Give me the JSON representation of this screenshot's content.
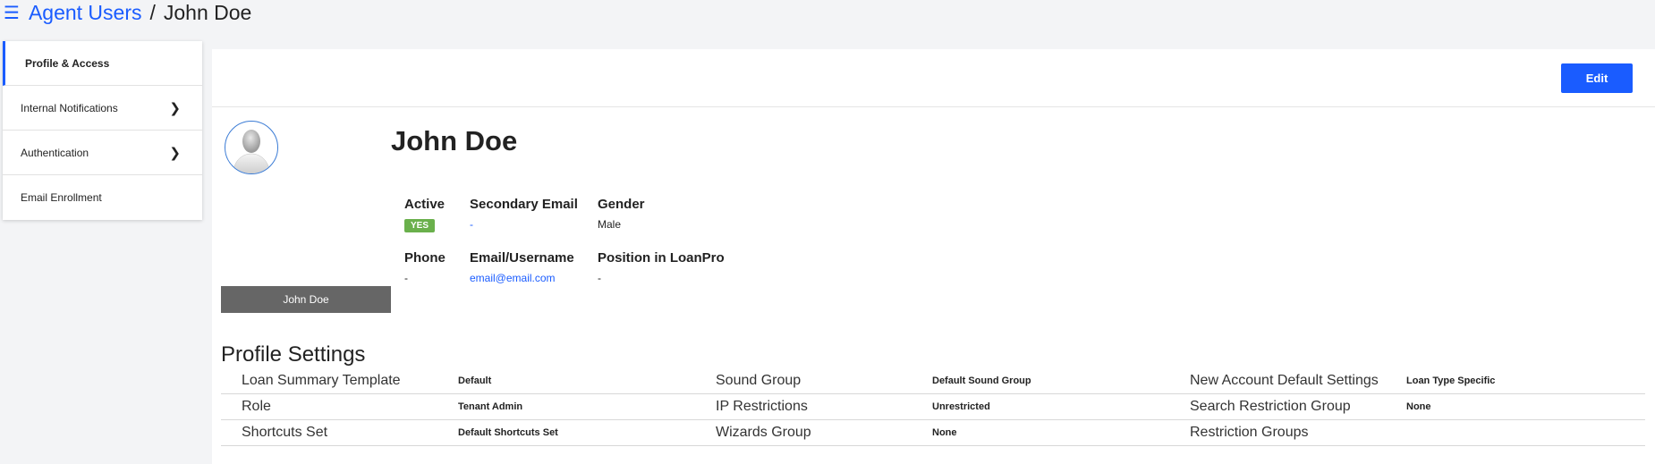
{
  "breadcrumb": {
    "menu_icon": "hamburger-icon",
    "parent": "Agent Users",
    "separator": "/",
    "current": "John Doe"
  },
  "sidebar": {
    "items": [
      {
        "label": "Profile & Access",
        "active": true,
        "has_chevron": false
      },
      {
        "label": "Internal Notifications",
        "active": false,
        "has_chevron": true
      },
      {
        "label": "Authentication",
        "active": false,
        "has_chevron": true
      },
      {
        "label": "Email Enrollment",
        "active": false,
        "has_chevron": false
      }
    ]
  },
  "header": {
    "edit_label": "Edit"
  },
  "profile": {
    "name": "John Doe",
    "name_bar": "John Doe",
    "fields": {
      "active": {
        "label": "Active",
        "value": "YES"
      },
      "secondary_email": {
        "label": "Secondary Email",
        "value": "-"
      },
      "gender": {
        "label": "Gender",
        "value": "Male"
      },
      "phone": {
        "label": "Phone",
        "value": "-"
      },
      "email": {
        "label": "Email/Username",
        "value": "email@email.com"
      },
      "position": {
        "label": "Position in LoanPro",
        "value": "-"
      }
    }
  },
  "settings": {
    "title": "Profile Settings",
    "rows": [
      [
        {
          "label": "Loan Summary Template",
          "value": "Default"
        },
        {
          "label": "Sound Group",
          "value": "Default Sound Group"
        },
        {
          "label": "New Account Default Settings",
          "value": "Loan Type Specific"
        }
      ],
      [
        {
          "label": "Role",
          "value": "Tenant Admin"
        },
        {
          "label": "IP Restrictions",
          "value": "Unrestricted"
        },
        {
          "label": "Search Restriction Group",
          "value": "None"
        }
      ],
      [
        {
          "label": "Shortcuts Set",
          "value": "Default Shortcuts Set"
        },
        {
          "label": "Wizards Group",
          "value": "None"
        },
        {
          "label": "Restriction Groups",
          "value": ""
        }
      ]
    ]
  },
  "colors": {
    "accent": "#1a5cff",
    "badge_green": "#6ab04c",
    "name_bar": "#666666"
  }
}
